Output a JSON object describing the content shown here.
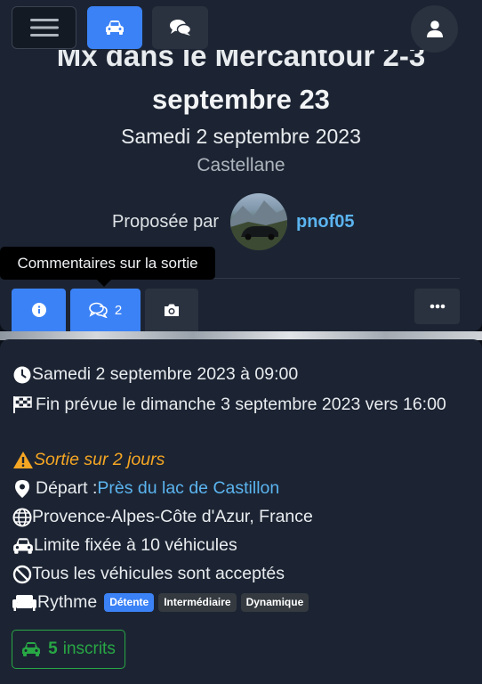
{
  "header": {
    "menu_icon": "hamburger-icon",
    "car_icon": "car-icon",
    "chat_icon": "comments-icon",
    "user_icon": "user-icon",
    "active_color": "#3b82f6"
  },
  "event": {
    "title_line1": "Mx dans le Mercantour 2-3",
    "title_line2": "septembre 23",
    "date": "Samedi 2 septembre 2023",
    "location": "Castellane",
    "proposed_by_label": "Proposée par",
    "username": "pnof05"
  },
  "tooltip": "Commentaires sur la sortie",
  "tabs": {
    "info_icon": "info-icon",
    "comments_icon": "comments-icon",
    "comments_count": "2",
    "photos_icon": "camera-icon",
    "more_icon": "ellipsis-icon"
  },
  "details": {
    "start": "Samedi 2 septembre 2023 à 09:00",
    "end": "Fin prévue le dimanche 3 septembre 2023 vers 16:00",
    "duration": "Sortie sur 2 jours",
    "departure_label": "Départ : ",
    "departure_place": "Près du lac de Castillon",
    "region": "Provence-Alpes-Côte d'Azur, France",
    "vehicle_limit": "Limite fixée à 10 véhicules",
    "vehicles_accepted": "Tous les véhicules sont acceptés",
    "rhythm_label": "Rythme",
    "rhythm_options": [
      "Détente",
      "Intermédiaire",
      "Dynamique"
    ],
    "rhythm_selected": "Détente",
    "registered_count": "5",
    "registered_label": "inscrits",
    "warning_color": "#f5a623",
    "success_color": "#28a745"
  }
}
